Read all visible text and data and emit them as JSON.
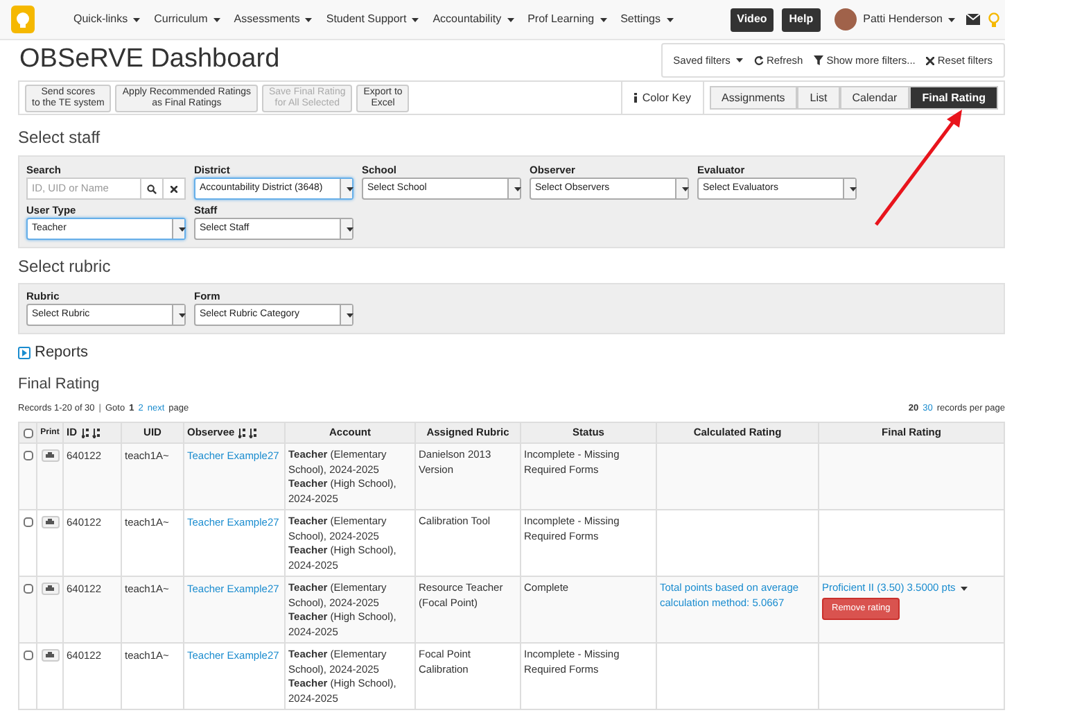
{
  "nav": {
    "menus": [
      "Quick-links",
      "Curriculum",
      "Assessments",
      "Student Support",
      "Accountability",
      "Prof Learning",
      "Settings"
    ],
    "buttons": [
      "Video",
      "Help"
    ],
    "user": "Patti Henderson"
  },
  "title": "OBSeRVE Dashboard",
  "filter_actions": [
    "Saved filters",
    "Refresh",
    "Show more filters...",
    "Reset filters"
  ],
  "toolbar": {
    "actions": [
      {
        "label": "Send scores\nto the TE system",
        "disabled": false
      },
      {
        "label": "Apply Recommended Ratings\nas Final Ratings",
        "disabled": false
      },
      {
        "label": "Save Final Rating\nfor All Selected",
        "disabled": true
      },
      {
        "label": "Export to\nExcel",
        "disabled": false
      }
    ],
    "color_key": "Color Key",
    "views": [
      {
        "label": "Assignments",
        "selected": false
      },
      {
        "label": "List",
        "selected": false
      },
      {
        "label": "Calendar",
        "selected": false
      },
      {
        "label": "Final Rating",
        "selected": true
      }
    ]
  },
  "select_staff": {
    "heading": "Select staff",
    "fields": [
      {
        "kind": "search",
        "label": "Search",
        "placeholder": "ID, UID or Name"
      },
      {
        "kind": "select",
        "label": "District",
        "value": "Accountability District (3648)",
        "focused": true
      },
      {
        "kind": "select",
        "label": "School",
        "value": "Select School",
        "focused": false
      },
      {
        "kind": "select",
        "label": "Observer",
        "value": "Select Observers",
        "focused": false
      },
      {
        "kind": "select",
        "label": "Evaluator",
        "value": "Select Evaluators",
        "focused": false
      },
      {
        "kind": "select",
        "label": "User Type",
        "value": "Teacher",
        "focused": true
      },
      {
        "kind": "select",
        "label": "Staff",
        "value": "Select Staff",
        "focused": false
      }
    ]
  },
  "select_rubric": {
    "heading": "Select rubric",
    "fields": [
      {
        "label": "Rubric",
        "value": "Select Rubric"
      },
      {
        "label": "Form",
        "value": "Select Rubric Category"
      }
    ]
  },
  "reports": {
    "label": "Reports",
    "expanded": false
  },
  "final_rating": {
    "heading": "Final Rating",
    "pager": {
      "records": "Records 1-20 of 30",
      "separator": "|",
      "goto": "Goto",
      "pages": [
        {
          "label": "1",
          "selected": true
        },
        {
          "label": "2",
          "selected": false
        }
      ],
      "next": "next",
      "page": "page"
    },
    "per_page": {
      "options": [
        {
          "label": "20",
          "selected": true
        },
        {
          "label": "30",
          "selected": false
        }
      ],
      "label": "records per page"
    },
    "table": {
      "select_all_checked": false,
      "columns": [
        "Print",
        "ID",
        "UID",
        "Observee",
        "Account",
        "Assigned Rubric",
        "Status",
        "Calculated Rating",
        "Final Rating"
      ],
      "rows": [
        {
          "checked": false,
          "id": "640122",
          "uid": "teach1A~",
          "observee": "Teacher Example27",
          "account": [
            "**Teacher** (Elementary School), 2024-2025",
            "**Teacher** (High School), 2024-2025"
          ],
          "rubric": "Danielson 2013 Version",
          "status": "Incomplete - Missing Required Forms"
        },
        {
          "checked": false,
          "id": "640122",
          "uid": "teach1A~",
          "observee": "Teacher Example27",
          "account": [
            "**Teacher** (Elementary School), 2024-2025",
            "**Teacher** (High School), 2024-2025"
          ],
          "rubric": "Calibration Tool",
          "status": "Incomplete - Missing Required Forms"
        },
        {
          "checked": false,
          "id": "640122",
          "uid": "teach1A~",
          "observee": "Teacher Example27",
          "account": [
            "**Teacher** (Elementary School), 2024-2025",
            "**Teacher** (High School), 2024-2025"
          ],
          "rubric": "Resource Teacher (Focal Point)",
          "status": "Complete",
          "calculated": "Total points based on average calculation method: 5.0667",
          "final": {
            "rating": "Proficient II (3.50) 3.5000 pts",
            "remove": "Remove rating"
          }
        },
        {
          "checked": false,
          "id": "640122",
          "uid": "teach1A~",
          "observee": "Teacher Example27",
          "account": [
            "**Teacher** (Elementary School), 2024-2025",
            "**Teacher** (High School), 2024-2025"
          ],
          "rubric": "Focal Point Calibration",
          "status": "Incomplete - Missing Required Forms"
        }
      ]
    }
  }
}
